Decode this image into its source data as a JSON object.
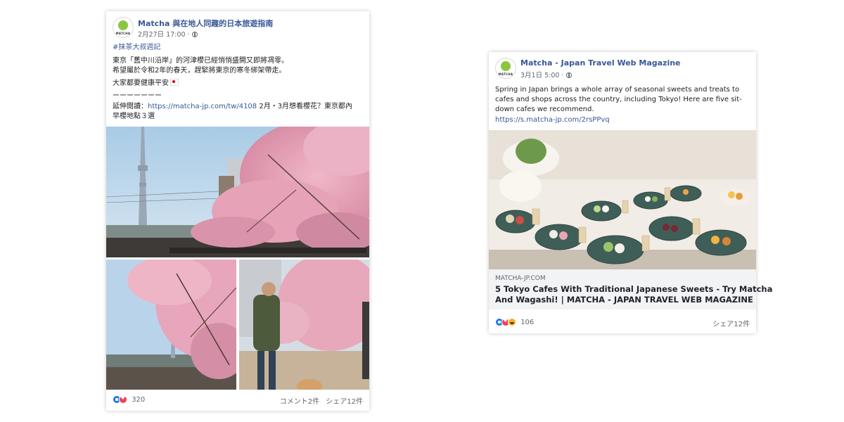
{
  "post_left": {
    "page_name": "Matcha 與在地人同趣的日本旅遊指南",
    "avatar_label": "MATCHA",
    "timestamp": "2月27日 17:00 · ",
    "hashtag": "#抹茶大叔週記",
    "lines": [
      "東京「舊中川沿岸」的河津櫻已經悄悄盛開又即將凋零。",
      "希望屬於令和2年的春天，趕緊將東京的寒冬綁架帶走。",
      "大家都要健康平安"
    ],
    "flag_emoji": "🇯🇵",
    "divider": "ーーーーーーー",
    "read_more_prefix": "延伸閱讀：",
    "read_more_url": "https://matcha-jp.com/tw/4108",
    "read_more_suffix": " 2月・3月想看櫻花？東京都內",
    "read_more_line2": "早櫻地點３選",
    "reaction_count": "320",
    "comments": "コメント2件",
    "shares": "シェア12件"
  },
  "post_right": {
    "page_name": "Matcha - Japan Travel Web Magazine",
    "avatar_label": "MATCHA",
    "timestamp": "3月1日 5:00 · ",
    "body_lines": [
      "Spring in Japan brings a whole array of seasonal sweets and treats to",
      "cafes and shops across the country, including Tokyo! Here are five sit-",
      "down cafes we recommend."
    ],
    "url": "https://s.matcha-jp.com/2rsPPvq",
    "link_domain": "MATCHA-JP.COM",
    "link_title_line1": "5 Tokyo Cafes With Traditional Japanese Sweets - Try Matcha",
    "link_title_line2": "And Wagashi! | MATCHA - JAPAN TRAVEL WEB MAGAZINE",
    "reaction_count": "106",
    "shares": "シェア12件"
  },
  "colors": {
    "link": "#385898",
    "like": "#1877f2",
    "love": "#f33e58",
    "haha": "#f7b125",
    "sakura": "#e8a3b8"
  }
}
